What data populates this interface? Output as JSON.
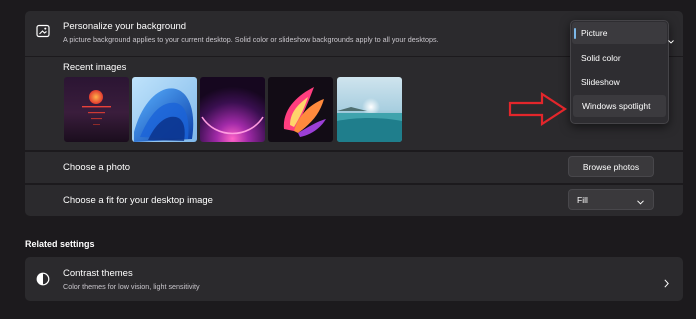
{
  "background": {
    "title": "Personalize your background",
    "description": "A picture background applies to your current desktop. Solid color or slideshow backgrounds apply to all your desktops.",
    "type_dropdown": {
      "selected": "Picture",
      "options": [
        "Picture",
        "Solid color",
        "Slideshow",
        "Windows spotlight"
      ]
    }
  },
  "recent_images": {
    "label": "Recent images"
  },
  "choose_photo": {
    "label": "Choose a photo",
    "button_label": "Browse photos"
  },
  "fit": {
    "label": "Choose a fit for your desktop image",
    "selected": "Fill"
  },
  "related": {
    "heading": "Related settings",
    "contrast_title": "Contrast themes",
    "contrast_subtitle": "Color themes for low vision, light sensitivity"
  },
  "icons": {
    "background": "picture-icon",
    "contrast": "contrast-icon",
    "chevron_down": "chevron-down-icon",
    "chevron_right": "chevron-right-icon",
    "annotation_arrow": "red-arrow"
  },
  "colors": {
    "accent": "#7cb8e8",
    "annotation": "#e3262b"
  }
}
